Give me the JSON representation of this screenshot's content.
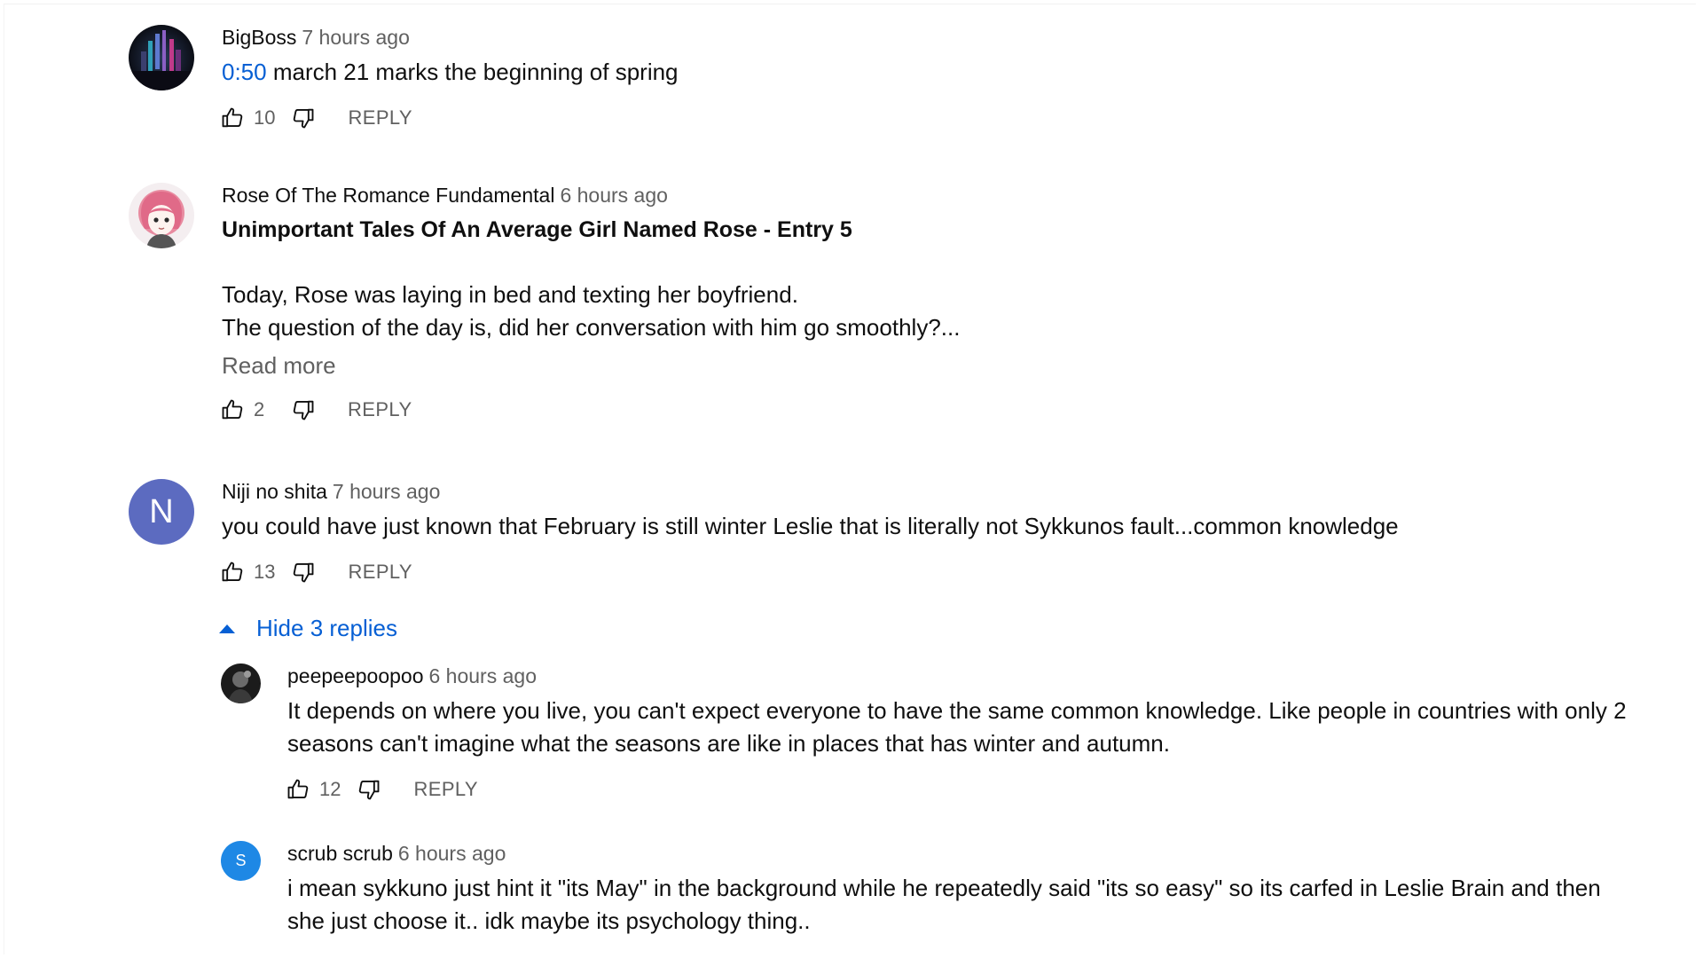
{
  "comments": [
    {
      "author": "BigBoss",
      "time": "7 hours ago",
      "timestamp": "0:50",
      "text": " march 21 marks the beginning of spring",
      "likes": "10",
      "reply_label": "REPLY"
    },
    {
      "author": "Rose Of The Romance Fundamental",
      "time": "6 hours ago",
      "title": "Unimportant Tales Of An Average Girl Named Rose - Entry 5",
      "line1": "Today, Rose was laying in bed and texting her boyfriend.",
      "line2": "The question of the day is, did her conversation with him go smoothly?...",
      "read_more": "Read more",
      "likes": "2",
      "reply_label": "REPLY"
    },
    {
      "author": "Niji no shita",
      "time": "7 hours ago",
      "avatar_letter": "N",
      "avatar_color": "#5c6bc0",
      "text": "you could have just known that February is still winter Leslie that is literally not Sykkunos fault...common knowledge",
      "likes": "13",
      "reply_label": "REPLY",
      "hide_replies_label": "Hide 3 replies"
    }
  ],
  "replies": [
    {
      "author": "peepeepoopoo",
      "time": "6 hours ago",
      "line1": "It depends on where you live, you can't expect everyone to have the same common knowledge. Like people in countries with only 2",
      "line2": "seasons can't imagine what the seasons are like in places that has winter and autumn.",
      "likes": "12",
      "reply_label": "REPLY"
    },
    {
      "author": "scrub scrub",
      "time": "6 hours ago",
      "avatar_letter": "S",
      "avatar_color": "#1e88e5",
      "line1": "i mean sykkuno just hint it \"its May\" in the background while he repeatedly said \"its so easy\" so its carfed in Leslie Brain and then",
      "line2": "she just choose it.. idk maybe its psychology thing.."
    }
  ],
  "colors": {
    "link_blue": "#065fd4",
    "secondary_text": "#606060"
  }
}
